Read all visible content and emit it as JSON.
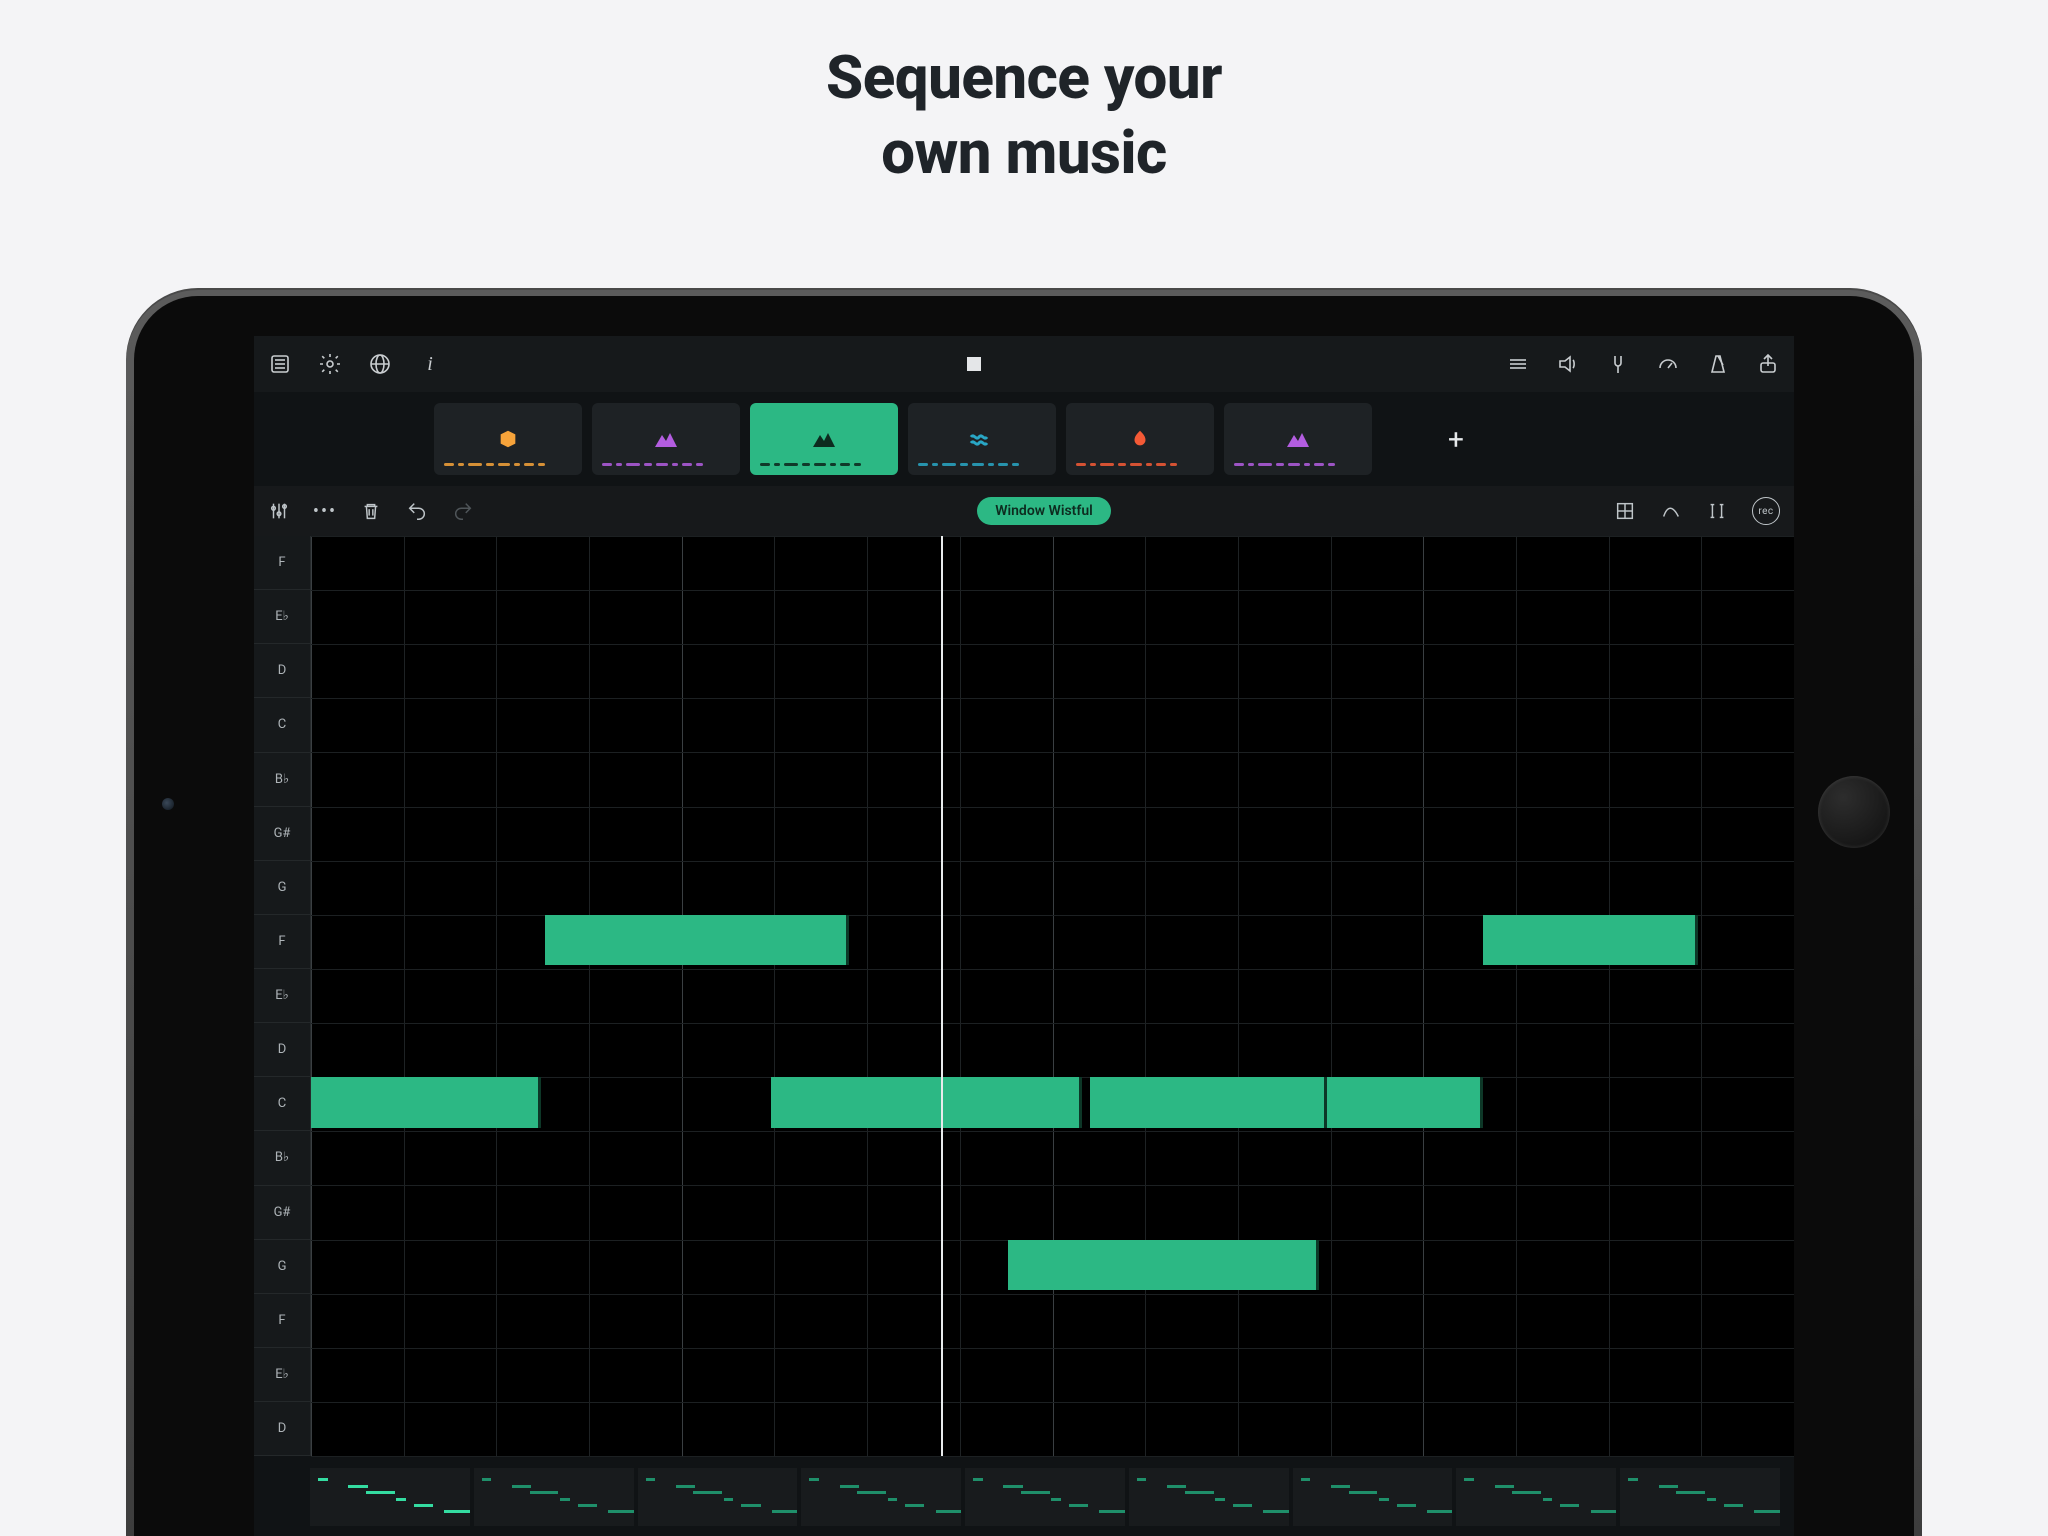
{
  "hero": {
    "line1": "Sequence your",
    "line2": "own music"
  },
  "colors": {
    "accent": "#2cb884",
    "orange": "#f6a33a",
    "purple": "#b35de0",
    "teal": "#29a7c6",
    "red": "#f45a36"
  },
  "pattern_label": "Window Wistful",
  "pitch_labels": [
    "F",
    "E♭",
    "D",
    "C",
    "B♭",
    "G#",
    "G",
    "F",
    "E♭",
    "D",
    "C",
    "B♭",
    "G#",
    "G",
    "F",
    "E♭",
    "D"
  ],
  "instruments": [
    {
      "name": "cube",
      "color": "#f6a33a",
      "active": false
    },
    {
      "name": "mountain-1",
      "color": "#b35de0",
      "active": false
    },
    {
      "name": "mountain-2",
      "color": "#0d2b1f",
      "active": true
    },
    {
      "name": "wave",
      "color": "#29a7c6",
      "active": false
    },
    {
      "name": "flame",
      "color": "#f45a36",
      "active": false
    },
    {
      "name": "mountain-3",
      "color": "#b35de0",
      "active": false
    }
  ],
  "notes": [
    {
      "row": 7,
      "start": 0.158,
      "len": 0.205
    },
    {
      "row": 7,
      "start": 0.79,
      "len": 0.145
    },
    {
      "row": 10,
      "start": 0.0,
      "len": 0.155
    },
    {
      "row": 10,
      "start": 0.31,
      "len": 0.21
    },
    {
      "row": 10,
      "start": 0.525,
      "len": 0.16
    },
    {
      "row": 10,
      "start": 0.685,
      "len": 0.105
    },
    {
      "row": 13,
      "start": 0.47,
      "len": 0.21
    }
  ],
  "playhead_pos": 0.425,
  "grid": {
    "columns": 16,
    "majors_every": 4,
    "rows": 17
  },
  "rec_label": "rec",
  "add_label": "+"
}
